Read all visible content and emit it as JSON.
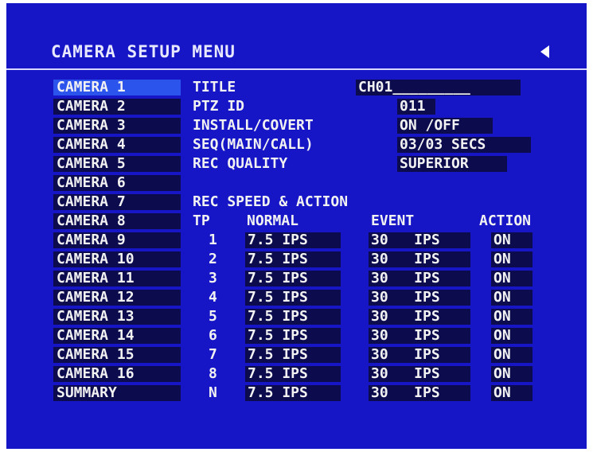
{
  "header": {
    "title": "CAMERA SETUP MENU"
  },
  "cameras": [
    "CAMERA 1",
    "CAMERA 2",
    "CAMERA 3",
    "CAMERA 4",
    "CAMERA 5",
    "CAMERA 6",
    "CAMERA 7",
    "CAMERA 8",
    "CAMERA 9",
    "CAMERA 10",
    "CAMERA 11",
    "CAMERA 12",
    "CAMERA 13",
    "CAMERA 14",
    "CAMERA 15",
    "CAMERA 16",
    "SUMMARY"
  ],
  "selected_camera": "CAMERA 1",
  "settings": {
    "title_label": "TITLE",
    "title_value": "CH01_________",
    "ptz_label": "PTZ ID",
    "ptz_value": "011",
    "install_label": "INSTALL/COVERT",
    "install_value": "ON /OFF",
    "seq_label": "SEQ(MAIN/CALL)",
    "seq_value": "03/03 SECS",
    "quality_label": "REC QUALITY",
    "quality_value": "SUPERIOR"
  },
  "rec": {
    "section_title": "REC SPEED & ACTION",
    "headers": {
      "tp": "TP",
      "normal": "NORMAL",
      "event": "EVENT",
      "action": "ACTION"
    },
    "rows": [
      {
        "tp": "1",
        "normal": "7.5 IPS",
        "event": "30   IPS",
        "action": "ON"
      },
      {
        "tp": "2",
        "normal": "7.5 IPS",
        "event": "30   IPS",
        "action": "ON"
      },
      {
        "tp": "3",
        "normal": "7.5 IPS",
        "event": "30   IPS",
        "action": "ON"
      },
      {
        "tp": "4",
        "normal": "7.5 IPS",
        "event": "30   IPS",
        "action": "ON"
      },
      {
        "tp": "5",
        "normal": "7.5 IPS",
        "event": "30   IPS",
        "action": "ON"
      },
      {
        "tp": "6",
        "normal": "7.5 IPS",
        "event": "30   IPS",
        "action": "ON"
      },
      {
        "tp": "7",
        "normal": "7.5 IPS",
        "event": "30   IPS",
        "action": "ON"
      },
      {
        "tp": "8",
        "normal": "7.5 IPS",
        "event": "30   IPS",
        "action": "ON"
      },
      {
        "tp": "N",
        "normal": "7.5 IPS",
        "event": "30   IPS",
        "action": "ON"
      }
    ]
  },
  "colors": {
    "background": "#1616c6",
    "field": "#0b0b4e",
    "highlight": "#2b54ec",
    "text": "#f2f2f2"
  }
}
